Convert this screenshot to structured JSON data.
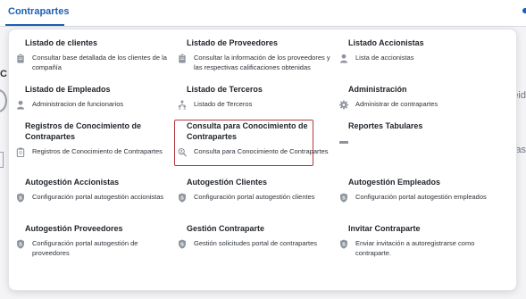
{
  "topbar": {
    "active_tab": "Contrapartes"
  },
  "background": {
    "left_letter": "C",
    "right_fragment_1": "eid",
    "right_fragment_2": "as"
  },
  "menu": {
    "items": [
      {
        "title": "Listado de clientes",
        "desc": "Consultar base detallada de los clientes de la compañía",
        "icon": "clipboard-icon"
      },
      {
        "title": "Listado de Proveedores",
        "desc": "Consultar la información de los proveedores y las respectivas calificaciones obtenidas",
        "icon": "clipboard-icon"
      },
      {
        "title": "Listado Accionistas",
        "desc": "Lista de accionistas",
        "icon": "person-icon"
      },
      {
        "title": "Listado de Empleados",
        "desc": "Administracion de funcionarios",
        "icon": "person-icon"
      },
      {
        "title": "Listado de Terceros",
        "desc": "Listado de Terceros",
        "icon": "people-network-icon"
      },
      {
        "title": "Administración",
        "desc": "Administrar de contrapartes",
        "icon": "gear-icon"
      },
      {
        "title": "Registros de Conocimiento de Contrapartes",
        "desc": "Registros de Conocimiento de Contrapartes",
        "icon": "clipboard-icon"
      },
      {
        "title": "Consulta para Conocimiento de Contrapartes",
        "desc": "Consulta para Conocimiento de Contrapartes",
        "icon": "search-person-icon"
      },
      {
        "title": "Reportes Tabulares",
        "desc": "",
        "icon": "dash-icon"
      },
      {
        "title": "Autogestión Accionistas",
        "desc": "Configuración portal autogestión accionistas",
        "icon": "shield-icon"
      },
      {
        "title": "Autogestión Clientes",
        "desc": "Configuración portal autogestión clientes",
        "icon": "shield-icon"
      },
      {
        "title": "Autogestión Empleados",
        "desc": "Configuración portal autogestión empleados",
        "icon": "shield-icon"
      },
      {
        "title": "Autogestión Proveedores",
        "desc": "Configuración portal autogestión de proveedores",
        "icon": "shield-icon"
      },
      {
        "title": "Gestión Contraparte",
        "desc": "Gestión solicitudes portal de contrapartes",
        "icon": "shield-icon"
      },
      {
        "title": "Invitar Contraparte",
        "desc": "Enviar invitación a autoregistrarse como contraparte.",
        "icon": "shield-icon"
      }
    ]
  }
}
